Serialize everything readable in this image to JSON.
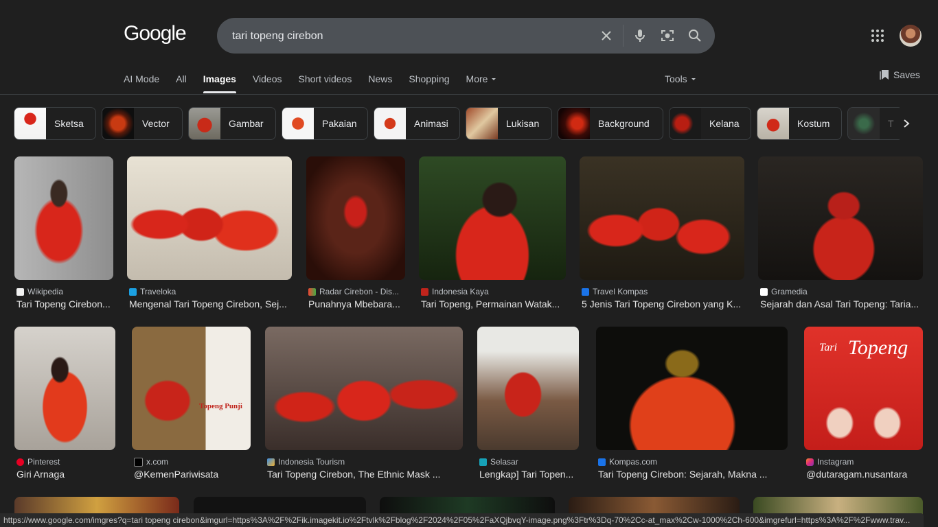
{
  "header": {
    "logo": "Google",
    "query": "tari topeng cirebon",
    "tabs": [
      "AI Mode",
      "All",
      "Images",
      "Videos",
      "Short videos",
      "News",
      "Shopping",
      "More"
    ],
    "tools": "Tools",
    "saves": "Saves"
  },
  "chips": [
    "Sketsa",
    "Vector",
    "Gambar",
    "Pakaian",
    "Animasi",
    "Lukisan",
    "Background",
    "Kelana",
    "Kostum",
    "T"
  ],
  "results_row1": [
    {
      "source": "Wikipedia",
      "title": "Tari Topeng Cirebon..."
    },
    {
      "source": "Traveloka",
      "title": "Mengenal Tari Topeng Cirebon, Sej..."
    },
    {
      "source": "Radar Cirebon - Dis...",
      "title": "Punahnya Mbebara..."
    },
    {
      "source": "Indonesia Kaya",
      "title": "Tari Topeng, Permainan Watak..."
    },
    {
      "source": "Travel Kompas",
      "title": "5 Jenis Tari Topeng Cirebon yang K..."
    },
    {
      "source": "Gramedia",
      "title": "Sejarah dan Asal Tari Topeng: Taria..."
    }
  ],
  "results_row2": [
    {
      "source": "Pinterest",
      "title": "Giri Arnaga"
    },
    {
      "source": "x.com",
      "title": "@KemenPariwisata"
    },
    {
      "source": "Indonesia Tourism",
      "title": "Tari Topeng Cirebon, The Ethnic Mask ..."
    },
    {
      "source": "Selasar",
      "title": "Lengkap] Tari Topen..."
    },
    {
      "source": "Kompas.com",
      "title": "Tari Topeng Cirebon: Sejarah, Makna ..."
    },
    {
      "source": "Instagram",
      "title": "@dutaragam.nusantara"
    }
  ],
  "image_overlays": {
    "topeng_punji": "Topeng Punji",
    "tari": "Tari",
    "topeng": "Topeng"
  },
  "status_url": "https://www.google.com/imgres?q=tari topeng cirebon&imgurl=https%3A%2F%2Fik.imagekit.io%2Ftvlk%2Fblog%2F2024%2F05%2FaXQjbvqY-image.png%3Ftr%3Dq-70%2Cc-at_max%2Cw-1000%2Ch-600&imgrefurl=https%3A%2F%2Fwww.trav...",
  "colors": {
    "background": "#1f1f1f",
    "search_bg": "#4d5156",
    "costume_red": "#d8261b"
  }
}
